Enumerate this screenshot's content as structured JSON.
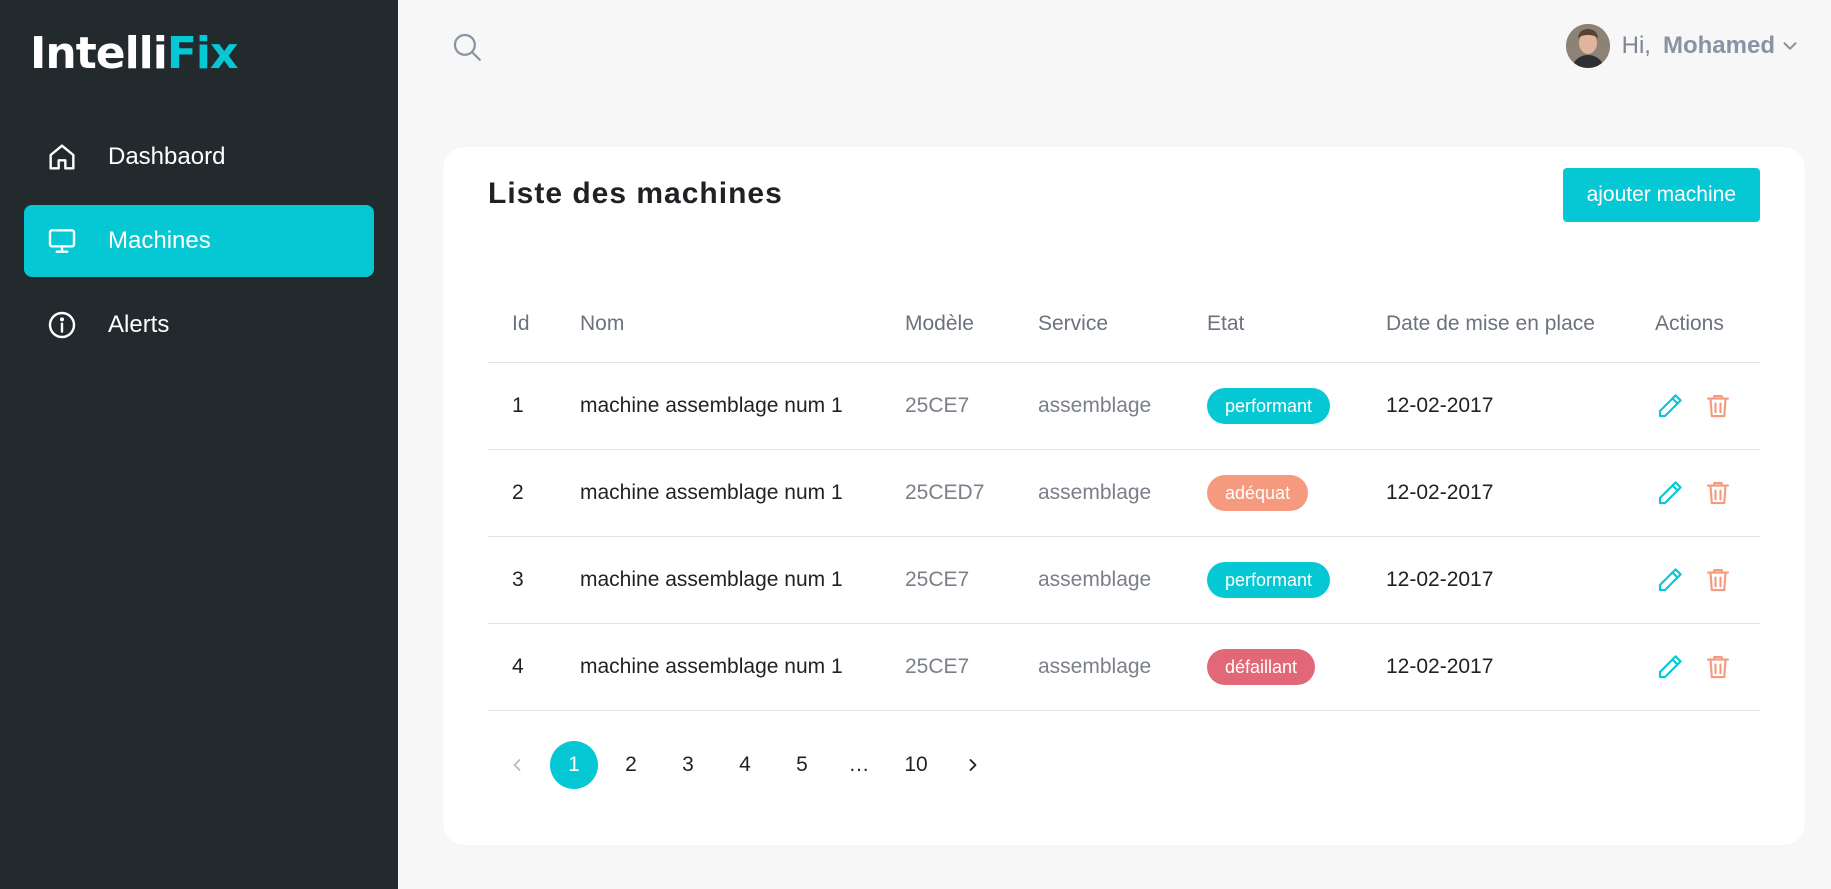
{
  "brand": {
    "part1": "Intelli",
    "part2": "Fix"
  },
  "sidebar": {
    "items": [
      {
        "label": "Dashbaord",
        "icon": "home-icon"
      },
      {
        "label": "Machines",
        "icon": "monitor-icon",
        "active": true
      },
      {
        "label": "Alerts",
        "icon": "info-icon"
      }
    ]
  },
  "header": {
    "greeting": "Hi,",
    "user_name": "Mohamed"
  },
  "card": {
    "title": "Liste des machines",
    "add_button": "ajouter machine"
  },
  "table": {
    "columns": [
      "Id",
      "Nom",
      "Modèle",
      "Service",
      "Etat",
      "Date de mise en place",
      "Actions"
    ],
    "rows": [
      {
        "id": "1",
        "nom": "machine assemblage num 1",
        "modele": "25CE7",
        "service": "assemblage",
        "etat": "performant",
        "etat_color": "#06c7d4",
        "date": "12-02-2017"
      },
      {
        "id": "2",
        "nom": "machine assemblage num 1",
        "modele": "25CED7",
        "service": "assemblage",
        "etat": "adéquat",
        "etat_color": "#f59a7e",
        "date": "12-02-2017"
      },
      {
        "id": "3",
        "nom": "machine assemblage num 1",
        "modele": "25CE7",
        "service": "assemblage",
        "etat": "performant",
        "etat_color": "#06c7d4",
        "date": "12-02-2017"
      },
      {
        "id": "4",
        "nom": "machine assemblage num 1",
        "modele": "25CE7",
        "service": "assemblage",
        "etat": "défaillant",
        "etat_color": "#e26777",
        "date": "12-02-2017"
      }
    ]
  },
  "pagination": {
    "pages": [
      "1",
      "2",
      "3",
      "4",
      "5",
      "…",
      "10"
    ],
    "current": "1"
  },
  "colors": {
    "accent": "#06c7d4",
    "sidebar_bg": "#232a2d",
    "edit_icon": "#06c7d4",
    "delete_icon": "#f59a7e"
  }
}
